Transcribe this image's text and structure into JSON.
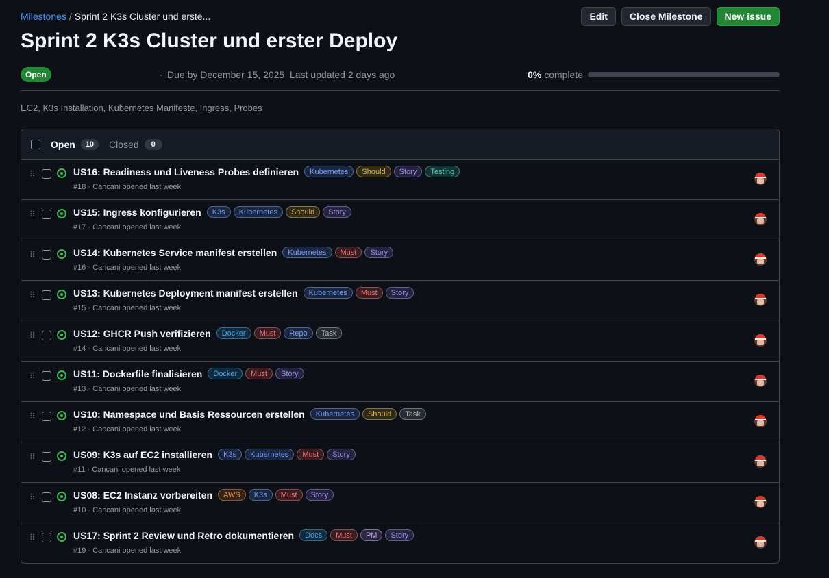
{
  "breadcrumb": {
    "root": "Milestones",
    "separator": "/",
    "current": "Sprint 2 K3s Cluster und erste..."
  },
  "actions": {
    "edit": "Edit",
    "close": "Close Milestone",
    "new_issue": "New issue"
  },
  "milestone": {
    "title": "Sprint 2 K3s Cluster und erster Deploy",
    "state": "Open",
    "due": "Due by December 15, 2025",
    "updated": "Last updated 2 days ago",
    "percent_label": "0%",
    "complete_label": "complete",
    "progress": 0,
    "description": "EC2, K3s Installation, Kubernetes Manifeste, Ingress, Probes"
  },
  "tabs": {
    "open_label": "Open",
    "open_count": "10",
    "closed_label": "Closed",
    "closed_count": "0"
  },
  "label_colors": {
    "Kubernetes": "#6f9cff",
    "K3s": "#6f9cff",
    "Should": "#e3b341",
    "Story": "#a48bf5",
    "Testing": "#56d4bc",
    "Must": "#ff6b6b",
    "Docker": "#3fa9f5",
    "Repo": "#6f9cff",
    "Task": "#b0b8c2",
    "AWS": "#f0883e",
    "Docs": "#3fa9f5",
    "PM": "#c9a8ff"
  },
  "issues": [
    {
      "title": "US16: Readiness und Liveness Probes definieren",
      "labels": [
        "Kubernetes",
        "Should",
        "Story",
        "Testing"
      ],
      "meta": "#18 · Cancani opened last week"
    },
    {
      "title": "US15: Ingress konfigurieren",
      "labels": [
        "K3s",
        "Kubernetes",
        "Should",
        "Story"
      ],
      "meta": "#17 · Cancani opened last week"
    },
    {
      "title": "US14: Kubernetes Service manifest erstellen",
      "labels": [
        "Kubernetes",
        "Must",
        "Story"
      ],
      "meta": "#16 · Cancani opened last week"
    },
    {
      "title": "US13: Kubernetes Deployment manifest erstellen",
      "labels": [
        "Kubernetes",
        "Must",
        "Story"
      ],
      "meta": "#15 · Cancani opened last week"
    },
    {
      "title": "US12: GHCR Push verifizieren",
      "labels": [
        "Docker",
        "Must",
        "Repo",
        "Task"
      ],
      "meta": "#14 · Cancani opened last week"
    },
    {
      "title": "US11: Dockerfile finalisieren",
      "labels": [
        "Docker",
        "Must",
        "Story"
      ],
      "meta": "#13 · Cancani opened last week"
    },
    {
      "title": "US10: Namespace und Basis Ressourcen erstellen",
      "labels": [
        "Kubernetes",
        "Should",
        "Task"
      ],
      "meta": "#12 · Cancani opened last week"
    },
    {
      "title": "US09: K3s auf EC2 installieren",
      "labels": [
        "K3s",
        "Kubernetes",
        "Must",
        "Story"
      ],
      "meta": "#11 · Cancani opened last week"
    },
    {
      "title": "US08: EC2 Instanz vorbereiten",
      "labels": [
        "AWS",
        "K3s",
        "Must",
        "Story"
      ],
      "meta": "#10 · Cancani opened last week"
    },
    {
      "title": "US17: Sprint 2 Review und Retro dokumentieren",
      "labels": [
        "Docs",
        "Must",
        "PM",
        "Story"
      ],
      "meta": "#19 · Cancani opened last week"
    }
  ]
}
